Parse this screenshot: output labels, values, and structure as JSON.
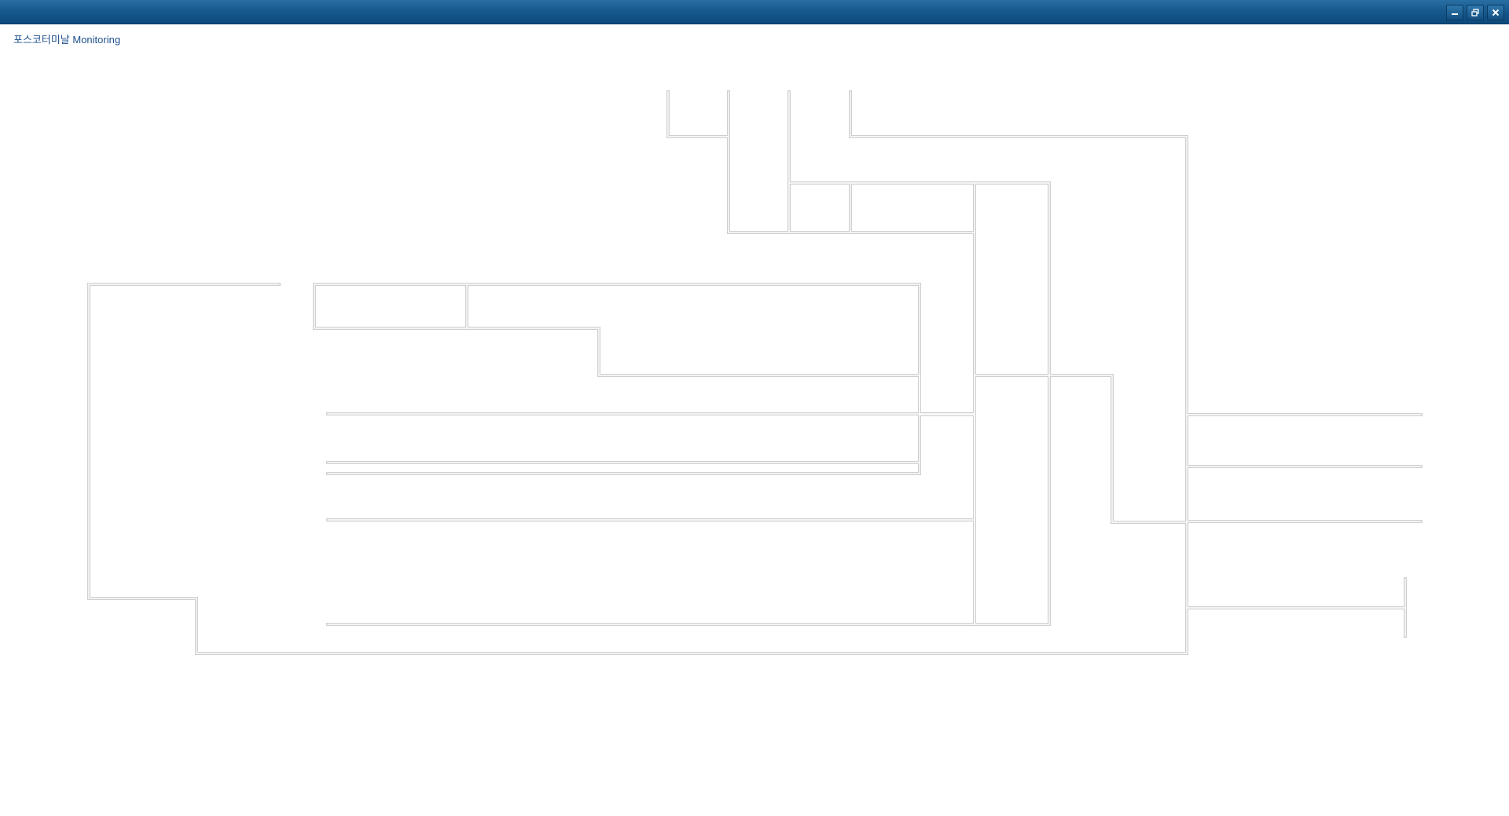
{
  "window": {
    "controls": [
      {
        "icon": "minimize-icon"
      },
      {
        "icon": "restore-icon"
      },
      {
        "icon": "close-icon"
      }
    ]
  },
  "page": {
    "title": "포스코터미날 Monitoring"
  },
  "colors": {
    "titlebar": "#165a8e",
    "title_text": "#1d4f8c",
    "wall_outer": "#cfcfcf",
    "wall_inner": "#ffffff"
  }
}
